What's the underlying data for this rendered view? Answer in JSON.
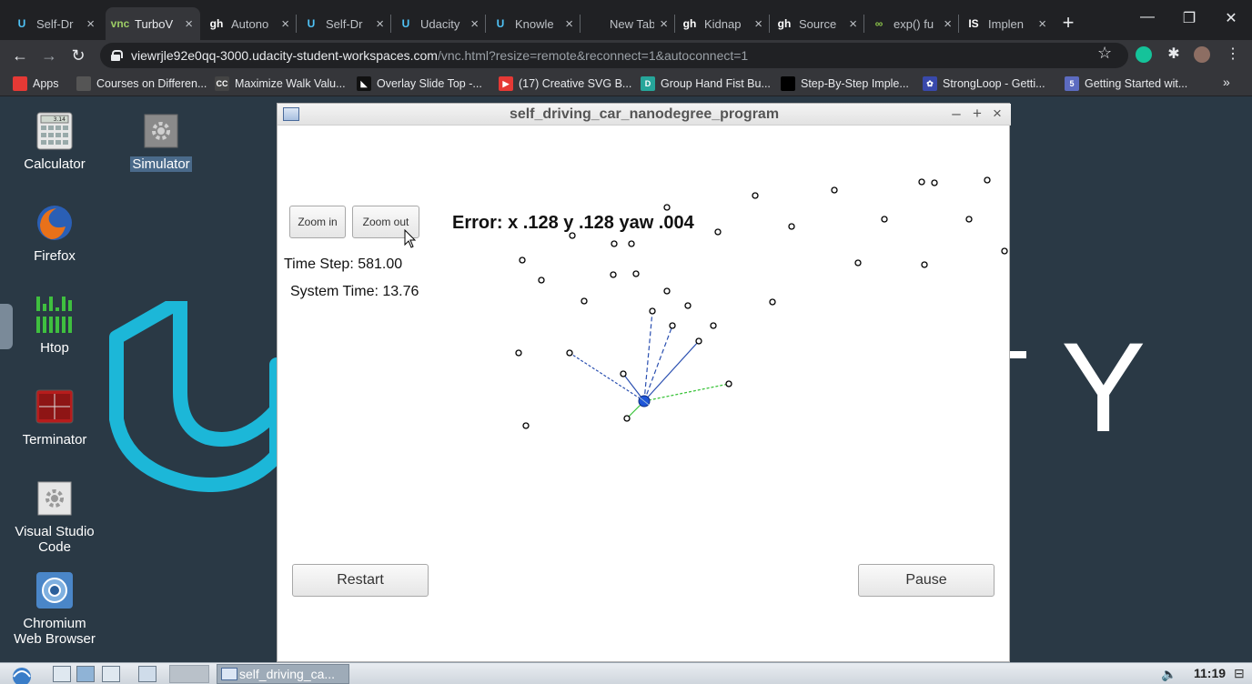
{
  "browser": {
    "tabs": [
      {
        "title": "Self-Dr",
        "fav": "U",
        "fav_color": "#4fc3f7"
      },
      {
        "title": "TurboV",
        "fav": "vnc",
        "fav_color": "#9ccc65",
        "active": true
      },
      {
        "title": "Autono",
        "fav": "gh",
        "fav_color": "#ffffff"
      },
      {
        "title": "Self-Dr",
        "fav": "U",
        "fav_color": "#4fc3f7"
      },
      {
        "title": "Udacity",
        "fav": "U",
        "fav_color": "#4fc3f7"
      },
      {
        "title": "Knowle",
        "fav": "U",
        "fav_color": "#4fc3f7"
      },
      {
        "title": "New Tab",
        "fav": "",
        "fav_color": "#202124"
      },
      {
        "title": "Kidnap",
        "fav": "gh",
        "fav_color": "#ffffff"
      },
      {
        "title": "Source",
        "fav": "gh",
        "fav_color": "#ffffff"
      },
      {
        "title": "exp() fu",
        "fav": "∞",
        "fav_color": "#8bc34a"
      },
      {
        "title": "Implen",
        "fav": "IS",
        "fav_color": "#ffffff"
      }
    ],
    "url_host": "viewrjle92e0qq-3000.udacity-student-workspaces.com",
    "url_rest": "/vnc.html?resize=remote&reconnect=1&autoconnect=1",
    "bookmarks": [
      {
        "label": "Apps",
        "color": "#e53935",
        "glyph": ""
      },
      {
        "label": "Courses on Differen...",
        "color": "#555",
        "glyph": ""
      },
      {
        "label": "Maximize Walk Valu...",
        "color": "#444",
        "glyph": "CC"
      },
      {
        "label": "Overlay Slide Top -...",
        "color": "#111",
        "glyph": "◣"
      },
      {
        "label": "(17) Creative SVG B...",
        "color": "#e53935",
        "glyph": "▶"
      },
      {
        "label": "Group Hand Fist Bu...",
        "color": "#26a69a",
        "glyph": "D"
      },
      {
        "label": "Step-By-Step Imple...",
        "color": "#000",
        "glyph": ""
      },
      {
        "label": "StrongLoop - Getti...",
        "color": "#3949ab",
        "glyph": "✿"
      },
      {
        "label": "Getting Started wit...",
        "color": "#5c6bc0",
        "glyph": "5"
      }
    ],
    "bookmarks_more": "»"
  },
  "desktop": {
    "icons": [
      {
        "label": "Calculator",
        "name": "calculator-icon",
        "selected": false
      },
      {
        "label": "Simulator",
        "name": "simulator-icon",
        "selected": true
      },
      {
        "label": "Firefox",
        "name": "firefox-icon",
        "selected": false
      },
      {
        "label": "Htop",
        "name": "htop-icon",
        "selected": false
      },
      {
        "label": "Terminator",
        "name": "terminator-icon",
        "selected": false
      },
      {
        "label": "Visual Studio Code",
        "name": "vscode-icon",
        "selected": false
      },
      {
        "label": "Chromium Web Browser",
        "name": "chromium-icon",
        "selected": false
      }
    ],
    "calculator_badge": "3.14",
    "wallpaper_letter": "Y",
    "accent": "#1cb7d8"
  },
  "sim": {
    "title": "self_driving_car_nanodegree_program",
    "zoom_in": "Zoom in",
    "zoom_out": "Zoom out",
    "time_step": "Time Step: 581.00",
    "system_time": "System Time: 13.76",
    "error": "Error: x .128 y .128 yaw .004",
    "restart": "Restart",
    "pause": "Pause",
    "win_min": "–",
    "win_max": "+",
    "win_close": "×"
  },
  "taskbar": {
    "task": "self_driving_ca...",
    "clock": "11:19"
  }
}
